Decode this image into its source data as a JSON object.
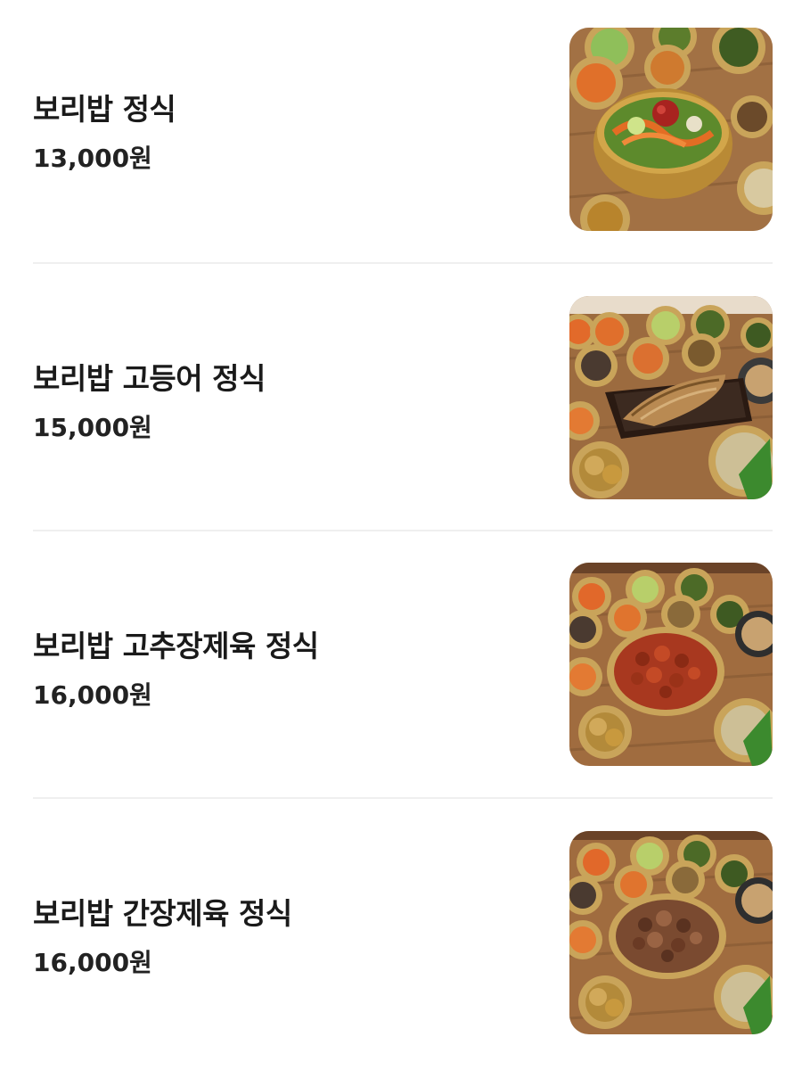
{
  "menu": {
    "items": [
      {
        "name": "보리밥 정식",
        "price": "13,000원",
        "image": "bibimbap-set-photo"
      },
      {
        "name": "보리밥 고등어 정식",
        "price": "15,000원",
        "image": "mackerel-set-photo"
      },
      {
        "name": "보리밥 고추장제육 정식",
        "price": "16,000원",
        "image": "spicy-pork-set-photo"
      },
      {
        "name": "보리밥 간장제육 정식",
        "price": "16,000원",
        "image": "soy-pork-set-photo"
      }
    ]
  }
}
